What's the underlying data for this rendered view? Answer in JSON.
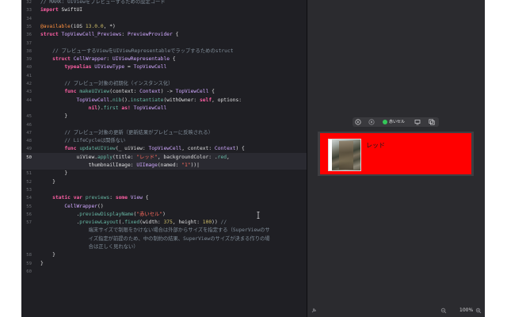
{
  "editor": {
    "current_line": "50",
    "lines": [
      {
        "n": "32",
        "segs": [
          {
            "c": "cm",
            "t": "// MARK: UIViewをプレビューするための設定コード"
          }
        ]
      },
      {
        "n": "33",
        "segs": [
          {
            "c": "kw",
            "t": "import"
          },
          {
            "c": "pl",
            "t": " SwiftUI"
          }
        ]
      },
      {
        "n": "34",
        "segs": []
      },
      {
        "n": "35",
        "segs": [
          {
            "c": "at",
            "t": "@available"
          },
          {
            "c": "pl",
            "t": "(iOS "
          },
          {
            "c": "nu",
            "t": "13.0.0"
          },
          {
            "c": "pl",
            "t": ", *)"
          }
        ]
      },
      {
        "n": "36",
        "segs": [
          {
            "c": "kw",
            "t": "struct"
          },
          {
            "c": "pl",
            "t": " "
          },
          {
            "c": "ty",
            "t": "TopViewCell_Previews"
          },
          {
            "c": "pl",
            "t": ": "
          },
          {
            "c": "ty",
            "t": "PreviewProvider"
          },
          {
            "c": "pl",
            "t": " {"
          }
        ]
      },
      {
        "n": "37",
        "segs": []
      },
      {
        "n": "38",
        "segs": [
          {
            "c": "cm",
            "t": "    // プレビューするViewをUIViewRepresentableでラップするためのstruct"
          }
        ]
      },
      {
        "n": "39",
        "segs": [
          {
            "c": "pl",
            "t": "    "
          },
          {
            "c": "kw",
            "t": "struct"
          },
          {
            "c": "pl",
            "t": " "
          },
          {
            "c": "ty",
            "t": "CellWrapper"
          },
          {
            "c": "pl",
            "t": ": "
          },
          {
            "c": "ty",
            "t": "UIViewRepresentable"
          },
          {
            "c": "pl",
            "t": " {"
          }
        ]
      },
      {
        "n": "40",
        "segs": [
          {
            "c": "pl",
            "t": "        "
          },
          {
            "c": "kw",
            "t": "typealias"
          },
          {
            "c": "pl",
            "t": " "
          },
          {
            "c": "ty",
            "t": "UIViewType"
          },
          {
            "c": "pl",
            "t": " = "
          },
          {
            "c": "ty",
            "t": "TopViewCell"
          }
        ]
      },
      {
        "n": "41",
        "segs": []
      },
      {
        "n": "42",
        "segs": [
          {
            "c": "cm",
            "t": "        // プレビュー対象の初期化（インスタンス化）"
          }
        ]
      },
      {
        "n": "43",
        "segs": [
          {
            "c": "pl",
            "t": "        "
          },
          {
            "c": "kw",
            "t": "func"
          },
          {
            "c": "pl",
            "t": " "
          },
          {
            "c": "fn",
            "t": "makeUIView"
          },
          {
            "c": "pl",
            "t": "(context: "
          },
          {
            "c": "ty",
            "t": "Context"
          },
          {
            "c": "pl",
            "t": ") -> "
          },
          {
            "c": "ty",
            "t": "TopViewCell"
          },
          {
            "c": "pl",
            "t": " {"
          }
        ]
      },
      {
        "n": "44",
        "segs": [
          {
            "c": "pl",
            "t": "            "
          },
          {
            "c": "ty",
            "t": "TopViewCell"
          },
          {
            "c": "pl",
            "t": "."
          },
          {
            "c": "fn",
            "t": "nib"
          },
          {
            "c": "pl",
            "t": "()."
          },
          {
            "c": "fn",
            "t": "instantiate"
          },
          {
            "c": "pl",
            "t": "(withOwner: "
          },
          {
            "c": "kw",
            "t": "self"
          },
          {
            "c": "pl",
            "t": ", options:"
          }
        ]
      },
      {
        "n": "",
        "segs": [
          {
            "c": "pl",
            "t": "                "
          },
          {
            "c": "kw",
            "t": "nil"
          },
          {
            "c": "pl",
            "t": ")."
          },
          {
            "c": "fn",
            "t": "first"
          },
          {
            "c": "pl",
            "t": " "
          },
          {
            "c": "kw",
            "t": "as!"
          },
          {
            "c": "pl",
            "t": " "
          },
          {
            "c": "ty",
            "t": "TopViewCell"
          }
        ]
      },
      {
        "n": "45",
        "segs": [
          {
            "c": "pl",
            "t": "        }"
          }
        ]
      },
      {
        "n": "46",
        "segs": []
      },
      {
        "n": "47",
        "segs": [
          {
            "c": "cm",
            "t": "        // プレビュー対象の更新（更新結果がプレビューに反映される）"
          }
        ]
      },
      {
        "n": "48",
        "segs": [
          {
            "c": "cm",
            "t": "        // LifeCycleは関係ない"
          }
        ]
      },
      {
        "n": "49",
        "segs": [
          {
            "c": "pl",
            "t": "        "
          },
          {
            "c": "kw",
            "t": "func"
          },
          {
            "c": "pl",
            "t": " "
          },
          {
            "c": "fn",
            "t": "updateUIView"
          },
          {
            "c": "pl",
            "t": "(_ uiView: "
          },
          {
            "c": "ty",
            "t": "TopViewCell"
          },
          {
            "c": "pl",
            "t": ", context: "
          },
          {
            "c": "ty",
            "t": "Context"
          },
          {
            "c": "pl",
            "t": ") {"
          }
        ]
      },
      {
        "n": "50",
        "segs": [
          {
            "c": "pl",
            "t": "            uiView."
          },
          {
            "c": "fn",
            "t": "apply"
          },
          {
            "c": "pl",
            "t": "(title: "
          },
          {
            "c": "st",
            "t": "\"レッド\""
          },
          {
            "c": "pl",
            "t": ", backgroundColor: ."
          },
          {
            "c": "fn",
            "t": "red"
          },
          {
            "c": "pl",
            "t": ","
          }
        ]
      },
      {
        "n": "",
        "segs": [
          {
            "c": "pl",
            "t": "                thumbnailImage: "
          },
          {
            "c": "ty",
            "t": "UIImage"
          },
          {
            "c": "pl",
            "t": "(named: "
          },
          {
            "c": "st",
            "t": "\"1\""
          },
          {
            "c": "pl",
            "t": "))|"
          }
        ]
      },
      {
        "n": "51",
        "segs": [
          {
            "c": "pl",
            "t": "        }"
          }
        ]
      },
      {
        "n": "52",
        "segs": [
          {
            "c": "pl",
            "t": "    }"
          }
        ]
      },
      {
        "n": "53",
        "segs": []
      },
      {
        "n": "54",
        "segs": [
          {
            "c": "pl",
            "t": "    "
          },
          {
            "c": "kw",
            "t": "static"
          },
          {
            "c": "pl",
            "t": " "
          },
          {
            "c": "kw",
            "t": "var"
          },
          {
            "c": "pl",
            "t": " "
          },
          {
            "c": "fn",
            "t": "previews"
          },
          {
            "c": "pl",
            "t": ": "
          },
          {
            "c": "kw",
            "t": "some"
          },
          {
            "c": "pl",
            "t": " "
          },
          {
            "c": "ty",
            "t": "View"
          },
          {
            "c": "pl",
            "t": " {"
          }
        ]
      },
      {
        "n": "55",
        "segs": [
          {
            "c": "pl",
            "t": "        "
          },
          {
            "c": "ty",
            "t": "CellWrapper"
          },
          {
            "c": "pl",
            "t": "()"
          }
        ]
      },
      {
        "n": "56",
        "segs": [
          {
            "c": "pl",
            "t": "            ."
          },
          {
            "c": "fn",
            "t": "previewDisplayName"
          },
          {
            "c": "pl",
            "t": "("
          },
          {
            "c": "st",
            "t": "\"赤いセル\""
          },
          {
            "c": "pl",
            "t": ")"
          }
        ]
      },
      {
        "n": "57",
        "segs": [
          {
            "c": "pl",
            "t": "            ."
          },
          {
            "c": "fn",
            "t": "previewLayout"
          },
          {
            "c": "pl",
            "t": "(."
          },
          {
            "c": "fn",
            "t": "fixed"
          },
          {
            "c": "pl",
            "t": "(width: "
          },
          {
            "c": "nu",
            "t": "375"
          },
          {
            "c": "pl",
            "t": ", height: "
          },
          {
            "c": "nu",
            "t": "100"
          },
          {
            "c": "pl",
            "t": ")) "
          },
          {
            "c": "cm",
            "t": "//"
          }
        ]
      },
      {
        "n": "",
        "segs": [
          {
            "c": "cm",
            "t": "                端末サイズで制限をかけない場合は外部からサイズを指定する（SuperViewのサ"
          }
        ]
      },
      {
        "n": "",
        "segs": [
          {
            "c": "cm",
            "t": "                イズ指定が前提のため、中の制約の結果、SuperViewのサイズが決まる作りの場"
          }
        ]
      },
      {
        "n": "",
        "segs": [
          {
            "c": "cm",
            "t": "                合は正しく見れない）"
          }
        ]
      },
      {
        "n": "58",
        "segs": [
          {
            "c": "pl",
            "t": "    }"
          }
        ]
      },
      {
        "n": "59",
        "segs": [
          {
            "c": "pl",
            "t": "}"
          }
        ]
      },
      {
        "n": "60",
        "segs": []
      }
    ]
  },
  "preview": {
    "toolbar": {
      "mode_label": "赤いセル"
    },
    "cell": {
      "title": "レッド",
      "background": "#ff0000"
    },
    "zoom": "100%"
  },
  "icons": {
    "live": "play-circle-icon",
    "inspect": "inspect-icon",
    "device": "device-icon",
    "duplicate": "duplicate-icon",
    "pin": "pin-icon",
    "zoom_out": "zoom-out-icon",
    "zoom_in": "zoom-in-icon"
  }
}
